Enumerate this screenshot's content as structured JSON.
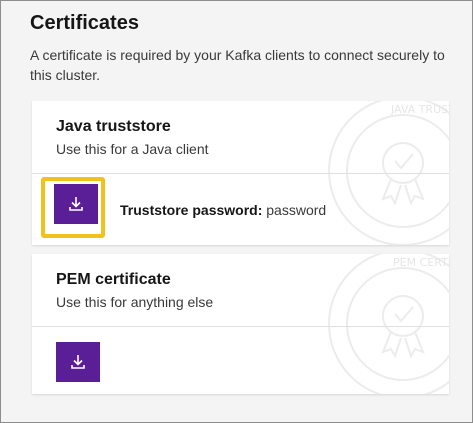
{
  "section": {
    "title": "Certificates",
    "description": "A certificate is required by your Kafka clients to connect securely to this cluster."
  },
  "java_card": {
    "title": "Java truststore",
    "subtitle": "Use this for a Java client",
    "password_label": "Truststore password:",
    "password_value": "password",
    "seal_text": "JAVA TRUSTSTORE"
  },
  "pem_card": {
    "title": "PEM certificate",
    "subtitle": "Use this for anything else",
    "seal_text": "PEM CERTIFICATE"
  },
  "icons": {
    "download": "download-icon",
    "seal": "certificate-seal-icon"
  },
  "colors": {
    "button": "#5a1e96",
    "highlight": "#f1c21b"
  }
}
